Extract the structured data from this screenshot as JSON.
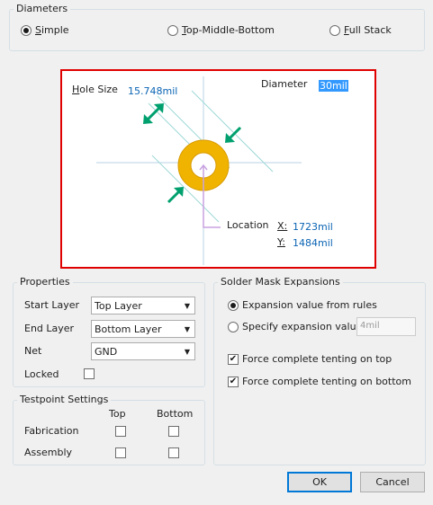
{
  "diameters": {
    "title": "Diameters",
    "options": [
      {
        "accel": "S",
        "rest": "imple",
        "selected": true
      },
      {
        "accel": "T",
        "rest": "op-Middle-Bottom",
        "selected": false
      },
      {
        "accel": "F",
        "rest": "ull Stack",
        "selected": false
      }
    ]
  },
  "preview": {
    "hole_size_accel": "H",
    "hole_size_rest": "ole Size",
    "hole_size_value": "15.748mil",
    "diameter_label": "Diameter",
    "diameter_value": "30mil",
    "location_label": "Location",
    "x_label": "X:",
    "x_value": "1723mil",
    "y_label": "Y:",
    "y_value": "1484mil",
    "colors": {
      "pad": "#f0b400",
      "pad_edge": "#d89a00",
      "arrow": "#00a06e",
      "guide": "#9fd8d8",
      "locator": "#c8a2e0"
    }
  },
  "properties": {
    "title": "Properties",
    "start_layer_label": "Start Layer",
    "start_layer_value": "Top Layer",
    "end_layer_label": "End Layer",
    "end_layer_value": "Bottom Layer",
    "net_label": "Net",
    "net_value": "GND",
    "locked_label": "Locked",
    "locked_checked": false
  },
  "testpoint": {
    "title": "Testpoint Settings",
    "col_top": "Top",
    "col_bottom": "Bottom",
    "row_fabrication": "Fabrication",
    "row_assembly": "Assembly"
  },
  "solder_mask": {
    "title": "Solder Mask Expansions",
    "option_rules": "Expansion value from rules",
    "option_specify": "Specify expansion value",
    "specify_value": "4mil",
    "tent_top": "Force complete tenting on top",
    "tent_bottom": "Force complete tenting on bottom",
    "tent_top_checked": true,
    "tent_bottom_checked": true
  },
  "buttons": {
    "ok": "OK",
    "cancel": "Cancel"
  },
  "glyphs": {
    "check": "✔",
    "dropdown": "▼"
  }
}
